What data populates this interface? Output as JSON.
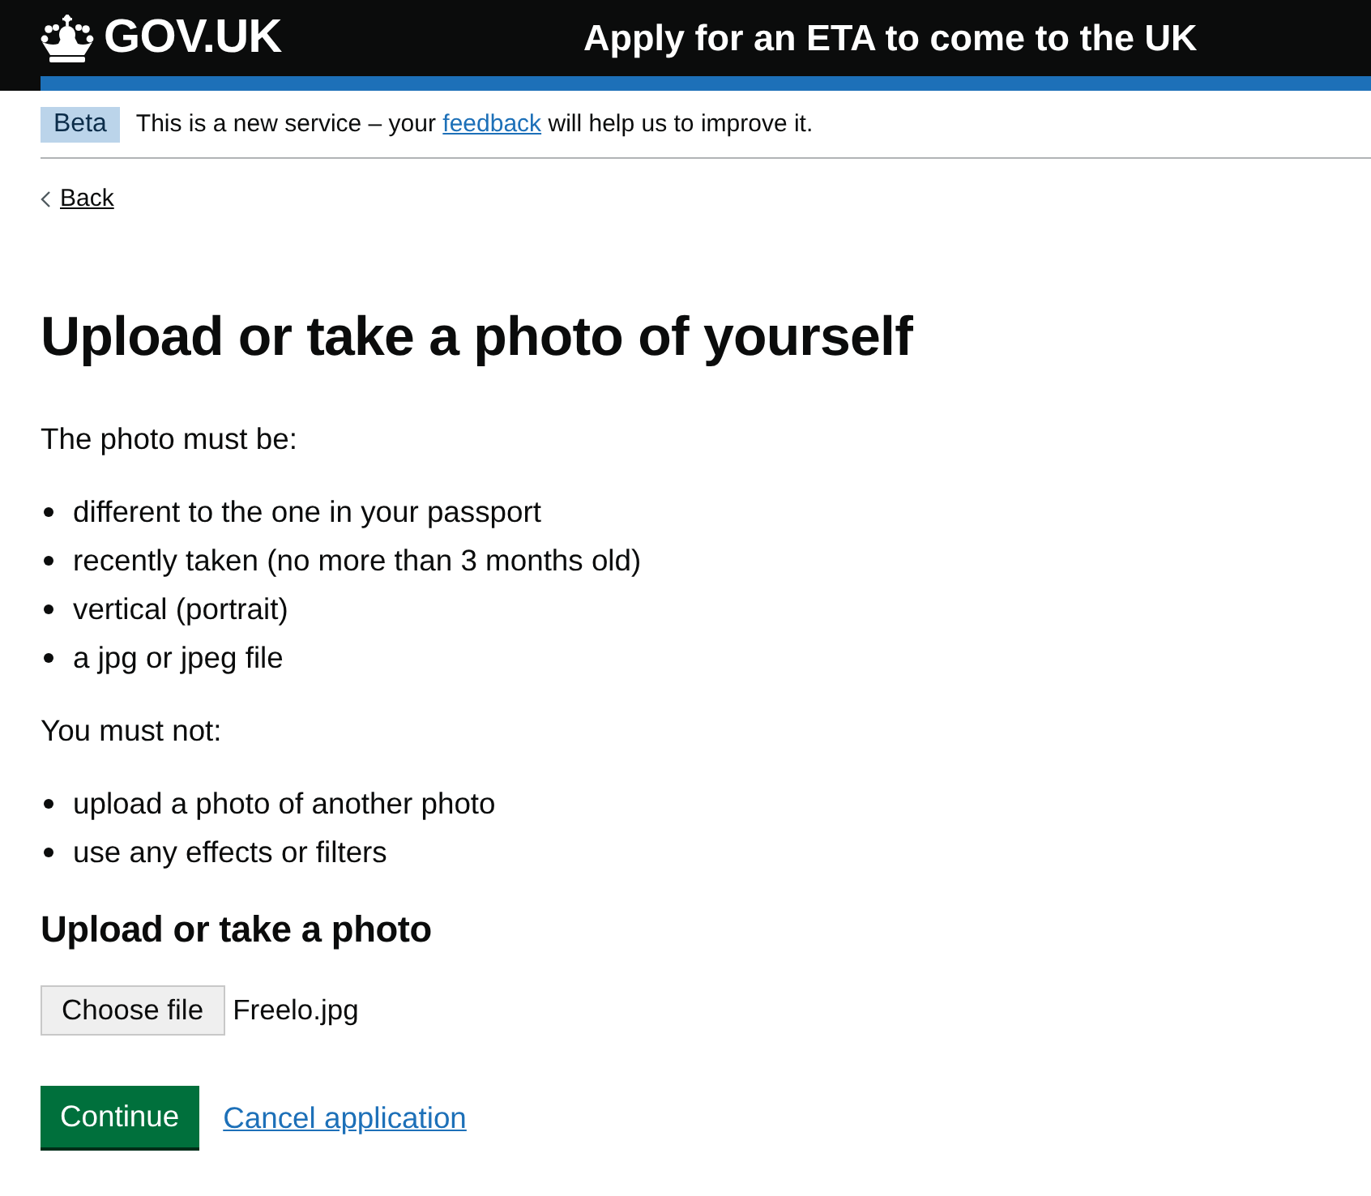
{
  "header": {
    "logo_text": "GOV.UK",
    "service_name": "Apply for an ETA to come to the UK"
  },
  "phase_banner": {
    "tag": "Beta",
    "text_before": "This is a new service – your",
    "link": "feedback",
    "text_after": "will help us to improve it."
  },
  "back_link": "Back",
  "heading": "Upload or take a photo of yourself",
  "sections": [
    {
      "intro": "The photo must be:",
      "items": [
        "different to the one in your passport",
        "recently taken (no more than 3 months old)",
        "vertical (portrait)",
        "a jpg or jpeg file"
      ]
    },
    {
      "intro": "You must not:",
      "items": [
        "upload a photo of another photo",
        "use any effects or filters"
      ]
    }
  ],
  "upload": {
    "label": "Upload or take a photo",
    "button": "Choose file",
    "file_name": "Freelo.jpg"
  },
  "actions": {
    "primary": "Continue",
    "secondary_link": "Cancel application"
  }
}
